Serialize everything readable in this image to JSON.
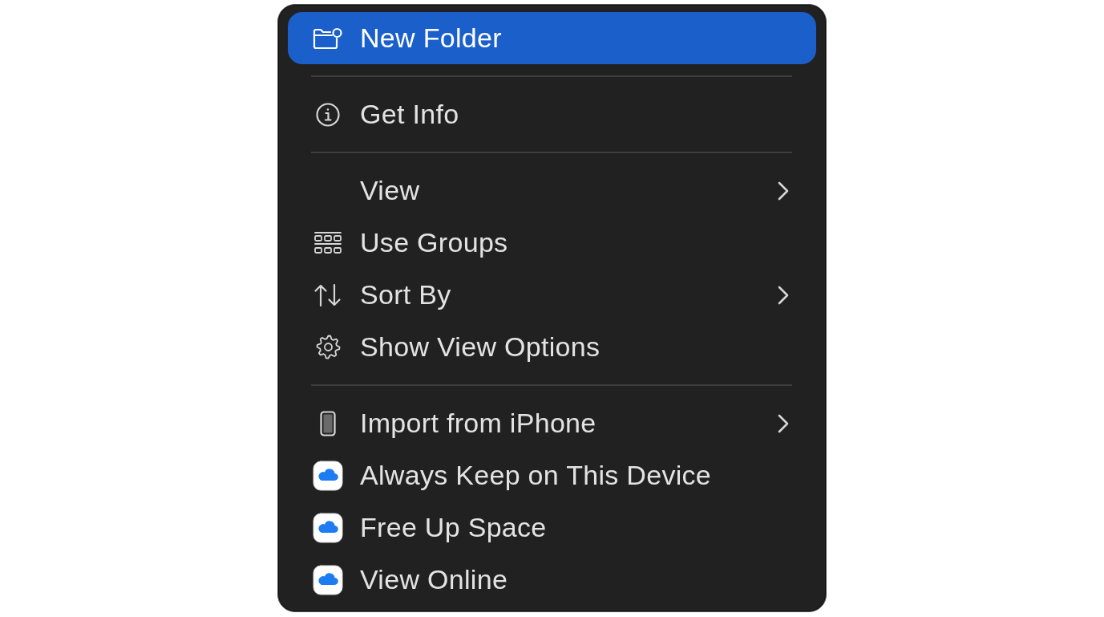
{
  "menu": {
    "sections": [
      {
        "items": [
          {
            "label": "New Folder",
            "selected": true,
            "submenu": false
          }
        ]
      },
      {
        "items": [
          {
            "label": "Get Info",
            "selected": false,
            "submenu": false
          }
        ]
      },
      {
        "items": [
          {
            "label": "View",
            "selected": false,
            "submenu": true
          },
          {
            "label": "Use Groups",
            "selected": false,
            "submenu": false
          },
          {
            "label": "Sort By",
            "selected": false,
            "submenu": true
          },
          {
            "label": "Show View Options",
            "selected": false,
            "submenu": false
          }
        ]
      },
      {
        "items": [
          {
            "label": "Import from iPhone",
            "selected": false,
            "submenu": true
          },
          {
            "label": "Always Keep on This Device",
            "selected": false,
            "submenu": false
          },
          {
            "label": "Free Up Space",
            "selected": false,
            "submenu": false
          },
          {
            "label": "View Online",
            "selected": false,
            "submenu": false
          }
        ]
      }
    ]
  }
}
